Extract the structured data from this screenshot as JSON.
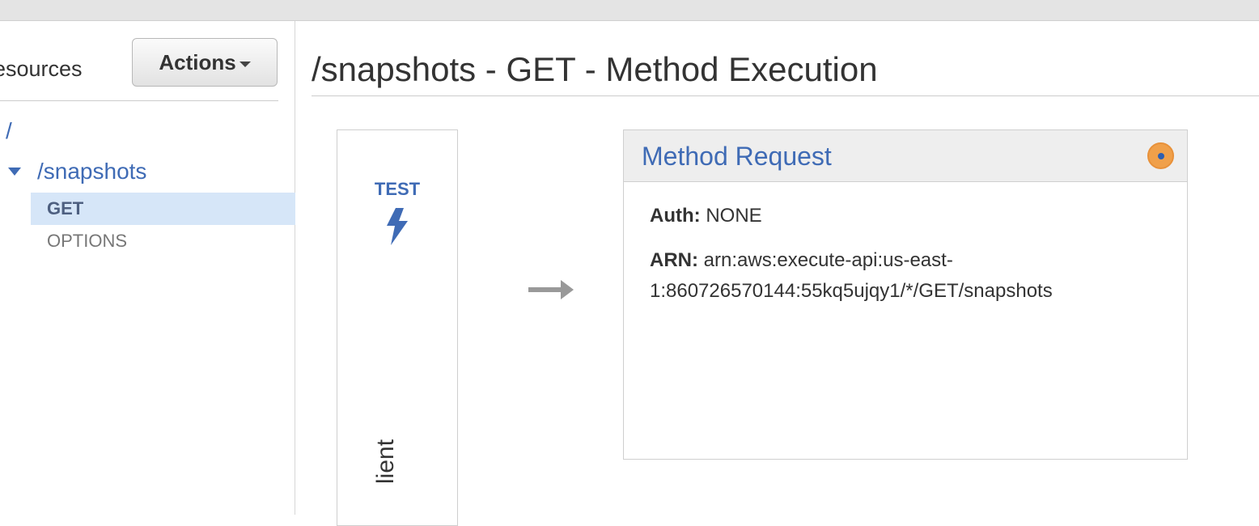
{
  "sidebar": {
    "title": "esources",
    "actions_label": "Actions",
    "tree": {
      "root": "/",
      "resource": "/snapshots",
      "methods": [
        "GET",
        "OPTIONS"
      ]
    }
  },
  "main": {
    "title": "/snapshots - GET - Method Execution",
    "client": {
      "test_label": "TEST",
      "label": "lient"
    },
    "method_request": {
      "title": "Method Request",
      "auth_label": "Auth:",
      "auth_value": "NONE",
      "arn_label": "ARN:",
      "arn_value": "arn:aws:execute-api:us-east-1:860726570144:55kq5ujqy1/*/GET/snapshots"
    }
  },
  "colors": {
    "link_blue": "#3f6bb5",
    "selected_bg": "#d6e6f8",
    "status_orange": "#f0a04a"
  }
}
